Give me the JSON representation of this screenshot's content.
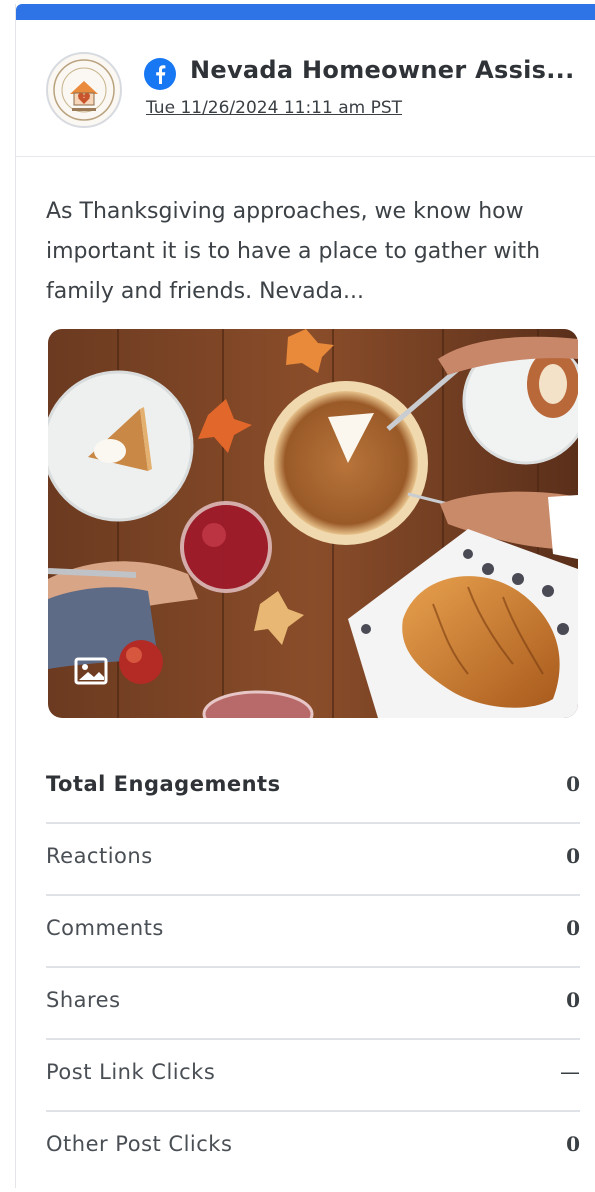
{
  "post": {
    "network_icon": "facebook-icon",
    "page_name": "Nevada Homeowner Assis...",
    "timestamp": "Tue 11/26/2024 11:11 am PST",
    "text": "As Thanksgiving approaches, we know how important it is to have a place to gather with family and friends. Nevada...",
    "media_type_icon": "image-icon"
  },
  "metrics": [
    {
      "label": "Total Engagements",
      "value": "0"
    },
    {
      "label": "Reactions",
      "value": "0"
    },
    {
      "label": "Comments",
      "value": "0"
    },
    {
      "label": "Shares",
      "value": "0"
    },
    {
      "label": "Post Link Clicks",
      "value": "—"
    },
    {
      "label": "Other Post Clicks",
      "value": "0"
    }
  ],
  "colors": {
    "accent_bar": "#2f74e6",
    "facebook_blue": "#1877f2"
  }
}
